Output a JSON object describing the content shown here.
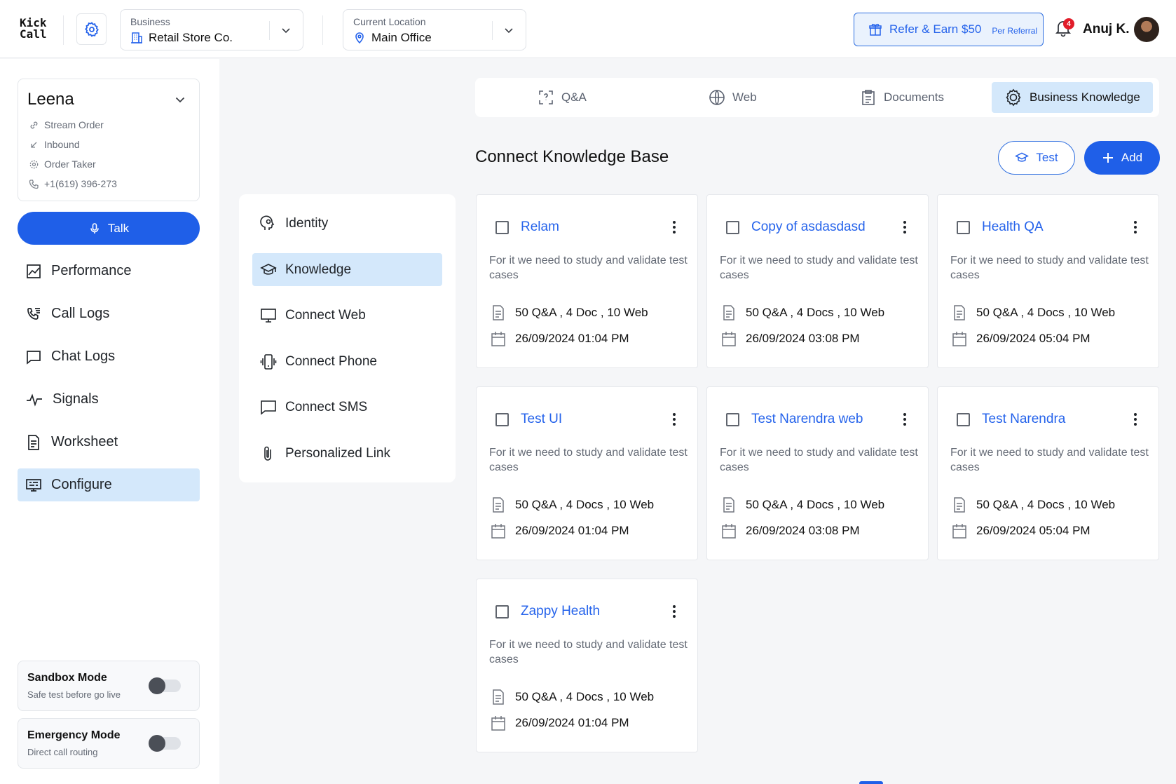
{
  "app": {
    "logo_line1": "Kick",
    "logo_line2": "Call"
  },
  "header": {
    "business": {
      "label": "Business",
      "value": "Retail Store Co."
    },
    "location": {
      "label": "Current Location",
      "value": "Main Office"
    },
    "refer": {
      "main": "Refer & Earn $50",
      "sub": "Per Referral"
    },
    "notifications_count": "4",
    "user_name": "Anuj K."
  },
  "agent": {
    "name": "Leena",
    "details": [
      "Stream Order",
      "Inbound",
      "Order Taker",
      "+1(619) 396-273"
    ]
  },
  "talk_label": "Talk",
  "nav": [
    {
      "label": "Performance",
      "icon": "chart-icon"
    },
    {
      "label": "Call Logs",
      "icon": "phone-list-icon"
    },
    {
      "label": "Chat Logs",
      "icon": "chat-icon"
    },
    {
      "label": "Signals",
      "icon": "pulse-icon"
    },
    {
      "label": "Worksheet",
      "icon": "document-icon"
    },
    {
      "label": "Configure",
      "icon": "configure-icon",
      "active": true
    }
  ],
  "toggles": [
    {
      "title": "Sandbox Mode",
      "subtitle": "Safe test before go live",
      "on": false
    },
    {
      "title": "Emergency Mode",
      "subtitle": "Direct call routing",
      "on": false
    }
  ],
  "config_menu": [
    {
      "label": "Identity",
      "icon": "identity-icon"
    },
    {
      "label": "Knowledge",
      "icon": "graduation-cap-icon",
      "active": true
    },
    {
      "label": "Connect Web",
      "icon": "monitor-icon"
    },
    {
      "label": "Connect Phone",
      "icon": "phone-vibrate-icon"
    },
    {
      "label": "Connect SMS",
      "icon": "message-icon"
    },
    {
      "label": "Personalized Link",
      "icon": "paperclip-icon"
    }
  ],
  "tabs": [
    {
      "label": "Q&A",
      "icon": "qa-icon"
    },
    {
      "label": "Web",
      "icon": "globe-icon"
    },
    {
      "label": "Documents",
      "icon": "clipboard-icon"
    },
    {
      "label": "Business Knowledge",
      "icon": "gear-brain-icon",
      "active": true
    }
  ],
  "section": {
    "title": "Connect Knowledge Base",
    "test_label": "Test",
    "add_label": "Add"
  },
  "cards": [
    {
      "title": "Relam",
      "description": "For it we need to study and validate test cases",
      "counts": "50 Q&A , 4 Doc , 10 Web",
      "date": "26/09/2024 01:04 PM"
    },
    {
      "title": "Copy of asdasdasd",
      "description": "For it we need to study and validate test cases",
      "counts": "50 Q&A , 4 Docs , 10 Web",
      "date": "26/09/2024 03:08 PM"
    },
    {
      "title": "Health QA",
      "description": "For it we need to study and validate test cases",
      "counts": "50 Q&A , 4 Docs , 10 Web",
      "date": "26/09/2024 05:04 PM"
    },
    {
      "title": "Test UI",
      "description": "For it we need to study and validate test cases",
      "counts": "50 Q&A , 4 Docs , 10 Web",
      "date": "26/09/2024 01:04 PM"
    },
    {
      "title": "Test Narendra web",
      "description": "For it we need to study and validate test cases",
      "counts": "50 Q&A , 4 Docs , 10 Web",
      "date": "26/09/2024 03:08 PM"
    },
    {
      "title": "Test Narendra",
      "description": "For it we need to study and validate test cases",
      "counts": "50 Q&A , 4 Docs , 10 Web",
      "date": "26/09/2024 05:04 PM"
    },
    {
      "title": "Zappy Health",
      "description": "For it we need to study and validate test cases",
      "counts": "50 Q&A , 4 Docs , 10 Web",
      "date": "26/09/2024 01:04 PM"
    }
  ],
  "colors": {
    "accent": "#1f5fe8",
    "active_bg": "#d4e8fb",
    "link": "#2563eb",
    "badge": "#e11d2a"
  }
}
